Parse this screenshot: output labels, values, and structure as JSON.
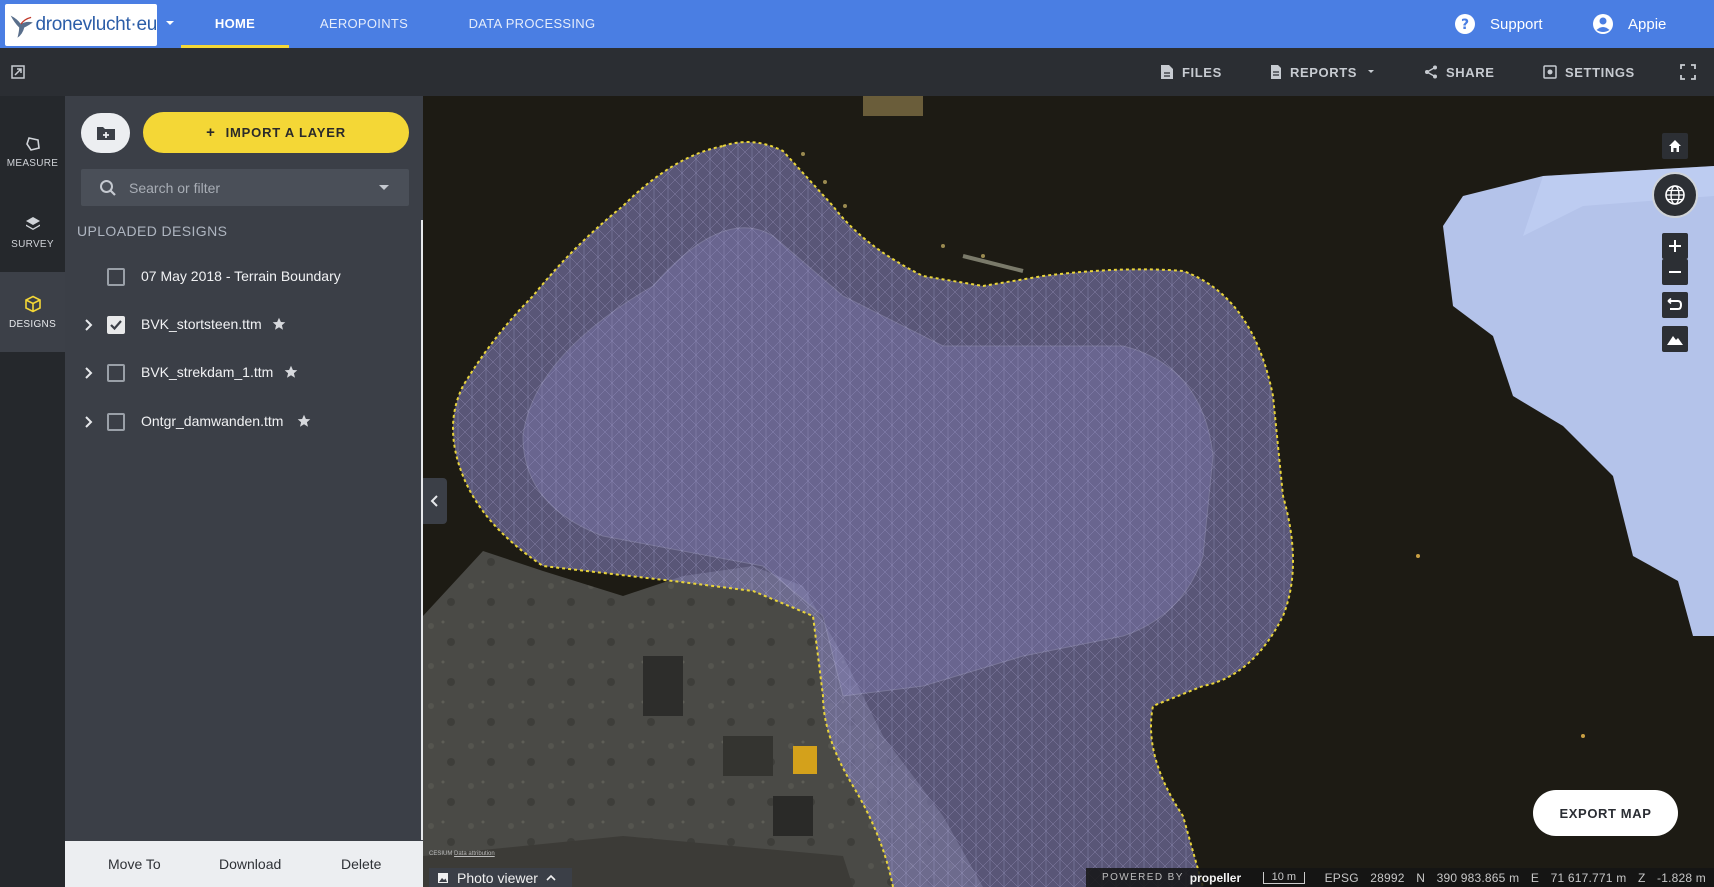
{
  "nav": {
    "logo_text": "dronevlucht·eu",
    "tabs": [
      {
        "label": "HOME",
        "active": true
      },
      {
        "label": "AEROPOINTS",
        "active": false
      },
      {
        "label": "DATA PROCESSING",
        "active": false
      }
    ],
    "support_label": "Support",
    "user_label": "Appie"
  },
  "toolbar": {
    "files_label": "FILES",
    "reports_label": "REPORTS",
    "share_label": "SHARE",
    "settings_label": "SETTINGS"
  },
  "rail": {
    "items": [
      {
        "label": "MEASURE",
        "icon": "polygon-icon"
      },
      {
        "label": "SURVEY",
        "icon": "layers-icon"
      },
      {
        "label": "DESIGNS",
        "icon": "cube-icon",
        "active": true
      }
    ]
  },
  "panel": {
    "import_label": "IMPORT A LAYER",
    "search_placeholder": "Search or filter",
    "section_title": "UPLOADED DESIGNS",
    "designs": [
      {
        "label": "07 May 2018 - Terrain Boundary",
        "checked": false,
        "expandable": false,
        "starred": false
      },
      {
        "label": "BVK_stortsteen.ttm",
        "checked": true,
        "expandable": true,
        "starred": true
      },
      {
        "label": "BVK_strekdam_1.ttm",
        "checked": false,
        "expandable": true,
        "starred": true
      },
      {
        "label": "Ontgr_damwanden.ttm",
        "checked": false,
        "expandable": true,
        "starred": true
      }
    ],
    "footer": {
      "move_label": "Move To",
      "download_label": "Download",
      "delete_label": "Delete"
    }
  },
  "map": {
    "export_label": "EXPORT MAP",
    "cesium_text": "CESIUM",
    "attribution_text": "Data attribution",
    "photo_viewer_label": "Photo viewer",
    "powered_label": "POWERED BY",
    "propeller_label": "propeller",
    "scale_label": "10 m",
    "epsg_label": "EPSG",
    "epsg_value": "28992",
    "n_label": "N",
    "n_value": "390 983.865 m",
    "e_label": "E",
    "e_value": "71 617.771 m",
    "z_label": "Z",
    "z_value": "-1.828 m"
  },
  "colors": {
    "nav_blue": "#4a7ee3",
    "accent_yellow": "#f4d736",
    "panel_bg": "#3b3f47",
    "design_overlay": "#8b86c9"
  }
}
